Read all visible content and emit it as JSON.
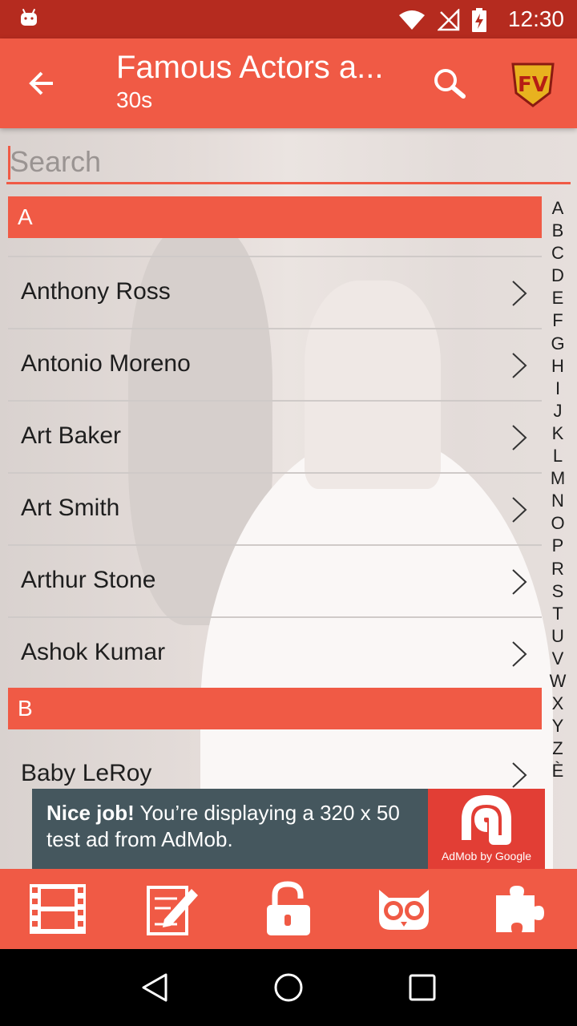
{
  "status_bar": {
    "time": "12:30"
  },
  "app_bar": {
    "title": "Famous Actors a...",
    "subtitle": "30s",
    "logo_text": "FV"
  },
  "search": {
    "placeholder": "Search",
    "value": ""
  },
  "sections": [
    {
      "header": "A",
      "items": [
        "Anthony Ross",
        "Antonio Moreno",
        "Art Baker",
        "Art Smith",
        "Arthur Stone",
        "Ashok Kumar"
      ]
    },
    {
      "header": "B",
      "items": [
        "Baby LeRoy"
      ]
    }
  ],
  "alphabet": [
    "A",
    "B",
    "C",
    "D",
    "E",
    "F",
    "G",
    "H",
    "I",
    "J",
    "K",
    "L",
    "M",
    "N",
    "O",
    "P",
    "R",
    "S",
    "T",
    "U",
    "V",
    "W",
    "X",
    "Y",
    "Z",
    "È"
  ],
  "ad": {
    "headline": "Nice job!",
    "body": " You’re displaying a 320 x 50 test ad from AdMob.",
    "caption": "AdMob by Google"
  },
  "tabs": [
    {
      "icon": "film-icon"
    },
    {
      "icon": "edit-note-icon"
    },
    {
      "icon": "unlock-icon"
    },
    {
      "icon": "owl-icon"
    },
    {
      "icon": "puzzle-icon"
    }
  ],
  "colors": {
    "accent": "#f05a45",
    "status_bar": "#b52b1f",
    "ad_bg": "#45575e",
    "ad_logo_bg": "#e23e35"
  }
}
